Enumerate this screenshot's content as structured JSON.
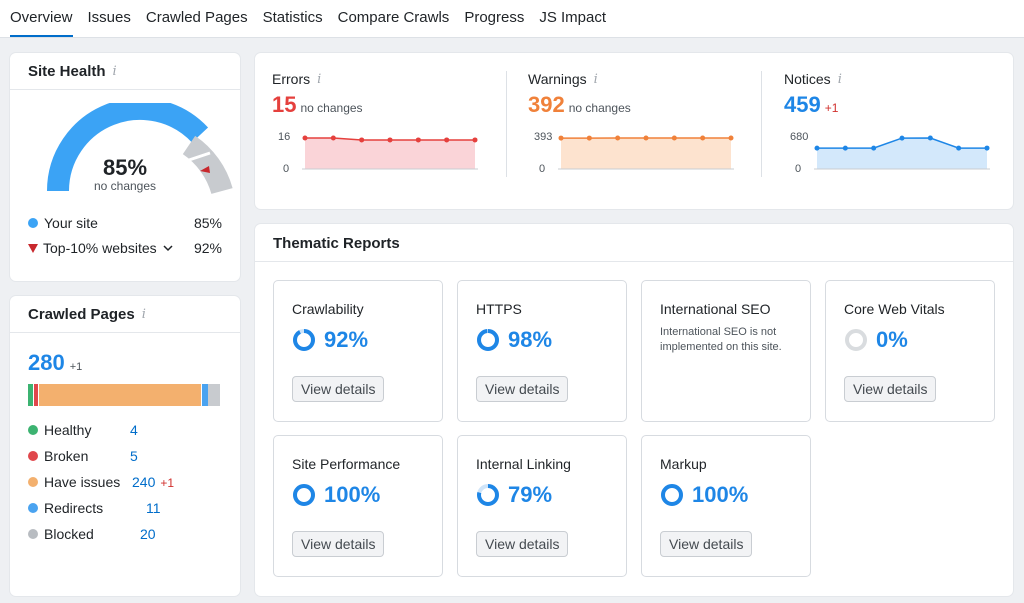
{
  "tabs": [
    "Overview",
    "Issues",
    "Crawled Pages",
    "Statistics",
    "Compare Crawls",
    "Progress",
    "JS Impact"
  ],
  "site_health": {
    "title": "Site Health",
    "percent": "85%",
    "sub": "no changes",
    "your_site_label": "Your site",
    "your_site_value": "85%",
    "top_label": "Top-10% websites",
    "top_value": "92%",
    "colors": {
      "site": "#3ba3f5",
      "top": "#c8282d",
      "gray": "#c8cbcf"
    }
  },
  "crawled_pages": {
    "title": "Crawled Pages",
    "total": "280",
    "delta": "+1",
    "rows": [
      {
        "label": "Healthy",
        "value": "4",
        "delta": "",
        "color": "#3cb371"
      },
      {
        "label": "Broken",
        "value": "5",
        "delta": "",
        "color": "#e0474c"
      },
      {
        "label": "Have issues",
        "value": "240",
        "delta": "+1",
        "color": "#f3b06e"
      },
      {
        "label": "Redirects",
        "value": "11",
        "delta": "",
        "color": "#4aa3f0"
      },
      {
        "label": "Blocked",
        "value": "20",
        "delta": "",
        "color": "#b8bcc1"
      }
    ]
  },
  "stats": [
    {
      "label": "Errors",
      "value": "15",
      "sub": "no changes",
      "sub_red": false,
      "color": "#e5403d",
      "fill": "#fad4d8",
      "axis_top": "16",
      "axis_bottom": "0",
      "series": [
        16,
        16,
        15,
        15,
        15,
        15,
        15
      ]
    },
    {
      "label": "Warnings",
      "value": "392",
      "sub": "no changes",
      "sub_red": false,
      "color": "#f0813a",
      "fill": "#fde3cf",
      "axis_top": "393",
      "axis_bottom": "0",
      "series": [
        392,
        392,
        393,
        393,
        393,
        393,
        393
      ]
    },
    {
      "label": "Notices",
      "value": "459",
      "sub": "+1",
      "sub_red": true,
      "color": "#1e86e6",
      "fill": "#d3e8fb",
      "axis_top": "680",
      "axis_bottom": "0",
      "series": [
        458,
        458,
        458,
        678,
        680,
        458,
        459
      ]
    }
  ],
  "thematic": {
    "title": "Thematic Reports",
    "button_label": "View details",
    "cards": [
      {
        "name": "Crawlability",
        "pct": "92%",
        "value": 92,
        "has_button": true,
        "note": ""
      },
      {
        "name": "HTTPS",
        "pct": "98%",
        "value": 98,
        "has_button": true,
        "note": ""
      },
      {
        "name": "International SEO",
        "pct": "",
        "value": null,
        "has_button": false,
        "note": "International SEO is not implemented on this site."
      },
      {
        "name": "Core Web Vitals",
        "pct": "0%",
        "value": 0,
        "has_button": true,
        "note": ""
      },
      {
        "name": "Site Performance",
        "pct": "100%",
        "value": 100,
        "has_button": true,
        "note": ""
      },
      {
        "name": "Internal Linking",
        "pct": "79%",
        "value": 79,
        "has_button": true,
        "note": ""
      },
      {
        "name": "Markup",
        "pct": "100%",
        "value": 100,
        "has_button": true,
        "note": ""
      }
    ]
  }
}
